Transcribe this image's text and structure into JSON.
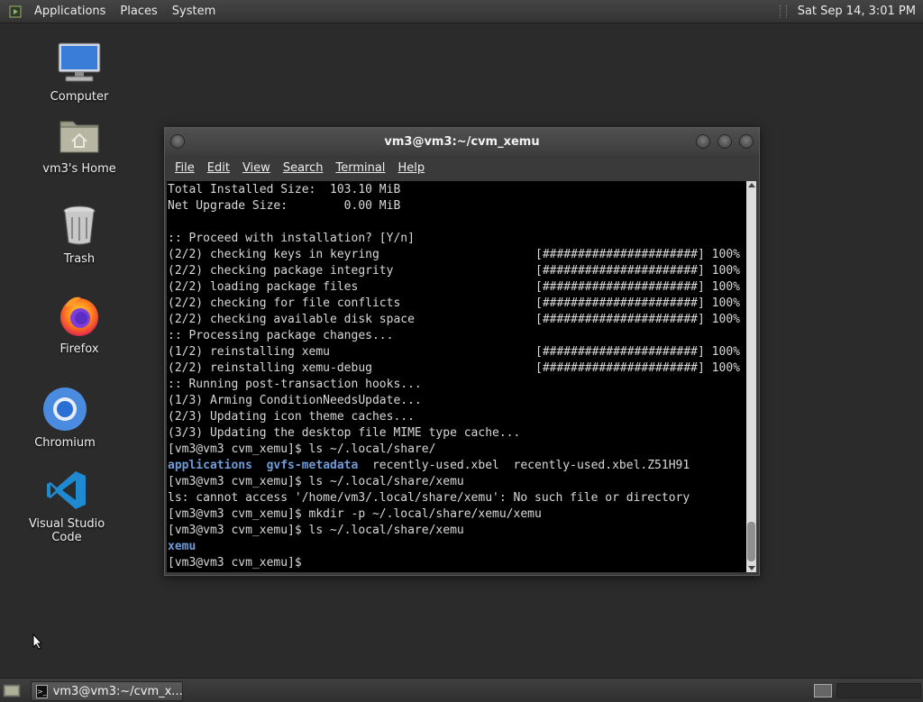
{
  "top_panel": {
    "applications": "Applications",
    "places": "Places",
    "system": "System",
    "clock": "Sat Sep 14,  3:01 PM"
  },
  "desktop_icons": {
    "computer": "Computer",
    "home": "vm3's Home",
    "trash": "Trash",
    "firefox": "Firefox",
    "chromium": "Chromium",
    "vscode": "Visual Studio Code"
  },
  "terminal": {
    "title": "vm3@vm3:~/cvm_xemu",
    "menu": [
      "File",
      "Edit",
      "View",
      "Search",
      "Terminal",
      "Help"
    ],
    "lines": [
      "Total Installed Size:  103.10 MiB",
      "Net Upgrade Size:        0.00 MiB",
      "",
      ":: Proceed with installation? [Y/n]"
    ],
    "progress_rows": [
      {
        "label": "(2/2) checking keys in keyring",
        "bar": "[######################]",
        "pct": "100%"
      },
      {
        "label": "(2/2) checking package integrity",
        "bar": "[######################]",
        "pct": "100%"
      },
      {
        "label": "(2/2) loading package files",
        "bar": "[######################]",
        "pct": "100%"
      },
      {
        "label": "(2/2) checking for file conflicts",
        "bar": "[######################]",
        "pct": "100%"
      },
      {
        "label": "(2/2) checking available disk space",
        "bar": "[######################]",
        "pct": "100%"
      }
    ],
    "processing": ":: Processing package changes...",
    "reinstall_rows": [
      {
        "label": "(1/2) reinstalling xemu",
        "bar": "[######################]",
        "pct": "100%"
      },
      {
        "label": "(2/2) reinstalling xemu-debug",
        "bar": "[######################]",
        "pct": "100%"
      }
    ],
    "hooks": [
      ":: Running post-transaction hooks...",
      "(1/3) Arming ConditionNeedsUpdate...",
      "(2/3) Updating icon theme caches...",
      "(3/3) Updating the desktop file MIME type cache..."
    ],
    "cmd1": "[vm3@vm3 cvm_xemu]$ ls ~/.local/share/",
    "ls_out": {
      "dir1": "applications",
      "dir2": "gvfs-metadata",
      "rest": "  recently-used.xbel  recently-used.xbel.Z51H91"
    },
    "cmd2": "[vm3@vm3 cvm_xemu]$ ls ~/.local/share/xemu",
    "err": "ls: cannot access '/home/vm3/.local/share/xemu': No such file or directory",
    "cmd3": "[vm3@vm3 cvm_xemu]$ mkdir -p ~/.local/share/xemu/xemu",
    "cmd4": "[vm3@vm3 cvm_xemu]$ ls ~/.local/share/xemu",
    "ls2_out": "xemu",
    "prompt": "[vm3@vm3 cvm_xemu]$ "
  },
  "bottom_panel": {
    "task_label": "vm3@vm3:~/cvm_x..."
  },
  "colors": {
    "desktop_bg": "#2b2b2b",
    "dir_blue": "#6f9bd8",
    "term_bg": "#000000",
    "term_fg": "#d8d8d8"
  }
}
